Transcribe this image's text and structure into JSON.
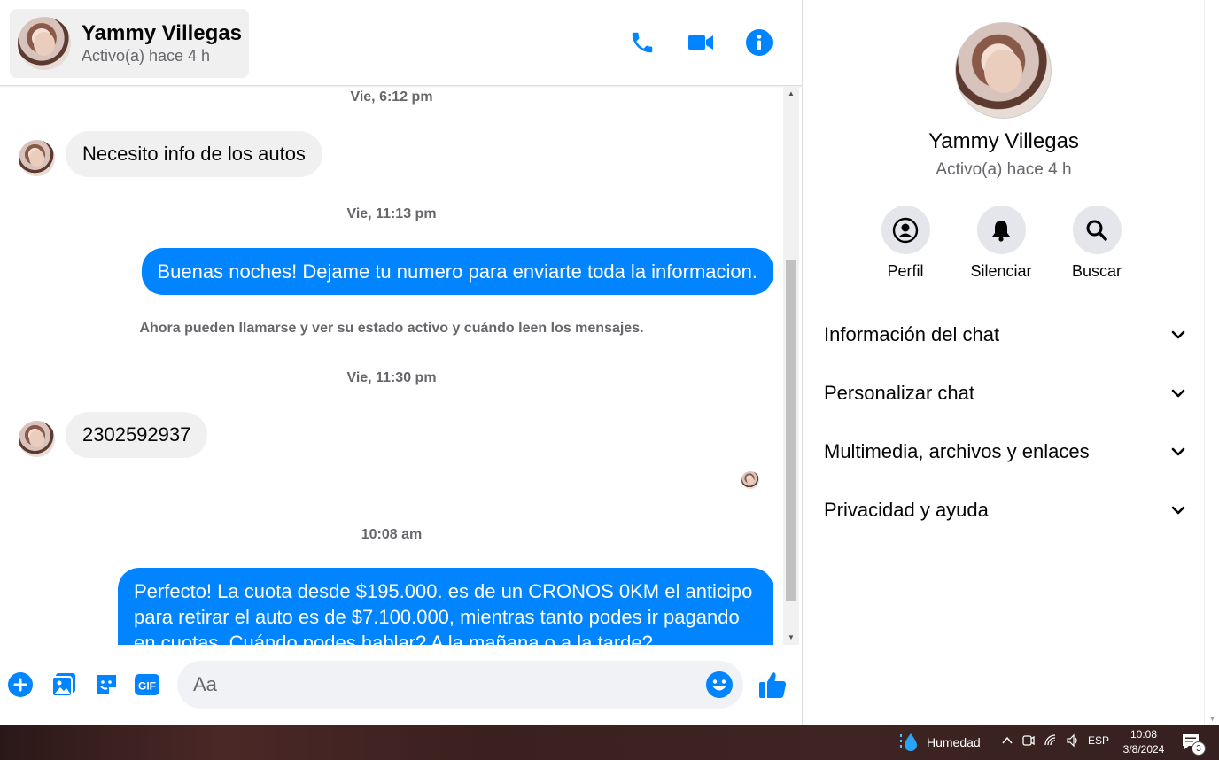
{
  "header": {
    "contact_name": "Yammy Villegas",
    "contact_status": "Activo(a) hace 4 h",
    "icons": [
      "phone-icon",
      "video-camera-icon",
      "info-icon"
    ]
  },
  "messages": {
    "ts1": "Vie, 6:12 pm",
    "in1": "Necesito info de los autos",
    "ts2": "Vie, 11:13 pm",
    "out1": "Buenas noches! Dejame tu numero para enviarte toda la informacion.",
    "system1": "Ahora pueden llamarse y ver su estado activo y cuándo leen los mensajes.",
    "ts3": "Vie, 11:30 pm",
    "in2": "2302592937",
    "ts4": "10:08 am",
    "out2": "Perfecto! La cuota desde $195.000. es de un CRONOS 0KM el anticipo para retirar el auto es de $7.100.000, mientras tanto podes ir pagando en cuotas. Cuándo podes hablar? A la mañana o a la tarde?"
  },
  "composer": {
    "placeholder": "Aa",
    "icons": [
      "plus-icon",
      "photo-icon",
      "sticker-icon",
      "gif-icon",
      "emoji-icon",
      "thumbs-up-icon"
    ]
  },
  "side_panel": {
    "name": "Yammy Villegas",
    "status": "Activo(a) hace 4 h",
    "actions": [
      {
        "label": "Perfil",
        "icon": "profile-icon"
      },
      {
        "label": "Silenciar",
        "icon": "bell-icon"
      },
      {
        "label": "Buscar",
        "icon": "search-icon"
      }
    ],
    "sections": [
      {
        "label": "Información del chat"
      },
      {
        "label": "Personalizar chat"
      },
      {
        "label": "Multimedia, archivos y enlaces"
      },
      {
        "label": "Privacidad y ayuda"
      }
    ]
  },
  "taskbar": {
    "weather_label": "Humedad",
    "language": "ESP",
    "time": "10:08",
    "date": "3/8/2024",
    "notification_count": "3"
  },
  "colors": {
    "accent": "#0084ff",
    "incoming_bubble": "#f0f0f0",
    "secondary_text": "#65676b"
  }
}
